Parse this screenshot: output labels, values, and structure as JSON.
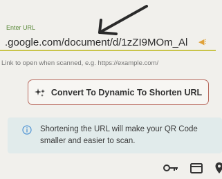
{
  "url_field": {
    "label": "Enter URL",
    "value": ".google.com/document/d/1zZI9MOm_Al",
    "hint": "Link to open when scanned, e.g. https://example.com/"
  },
  "convert_button": {
    "label": "Convert To Dynamic To Shorten URL"
  },
  "info": {
    "text": "Shortening the URL will make your QR Code smaller and easier to scan."
  },
  "icons": [
    "handwritten-arrow-icon",
    "link-icon",
    "sparkle-icon",
    "info-icon",
    "key-icon",
    "card-icon",
    "pin-icon"
  ],
  "colors": {
    "label": "#5b8a3a",
    "underline": "#c9c44a",
    "button_border": "#b86a5e",
    "info_bg": "#e1ebeb",
    "info_icon": "#5a9ad6"
  }
}
